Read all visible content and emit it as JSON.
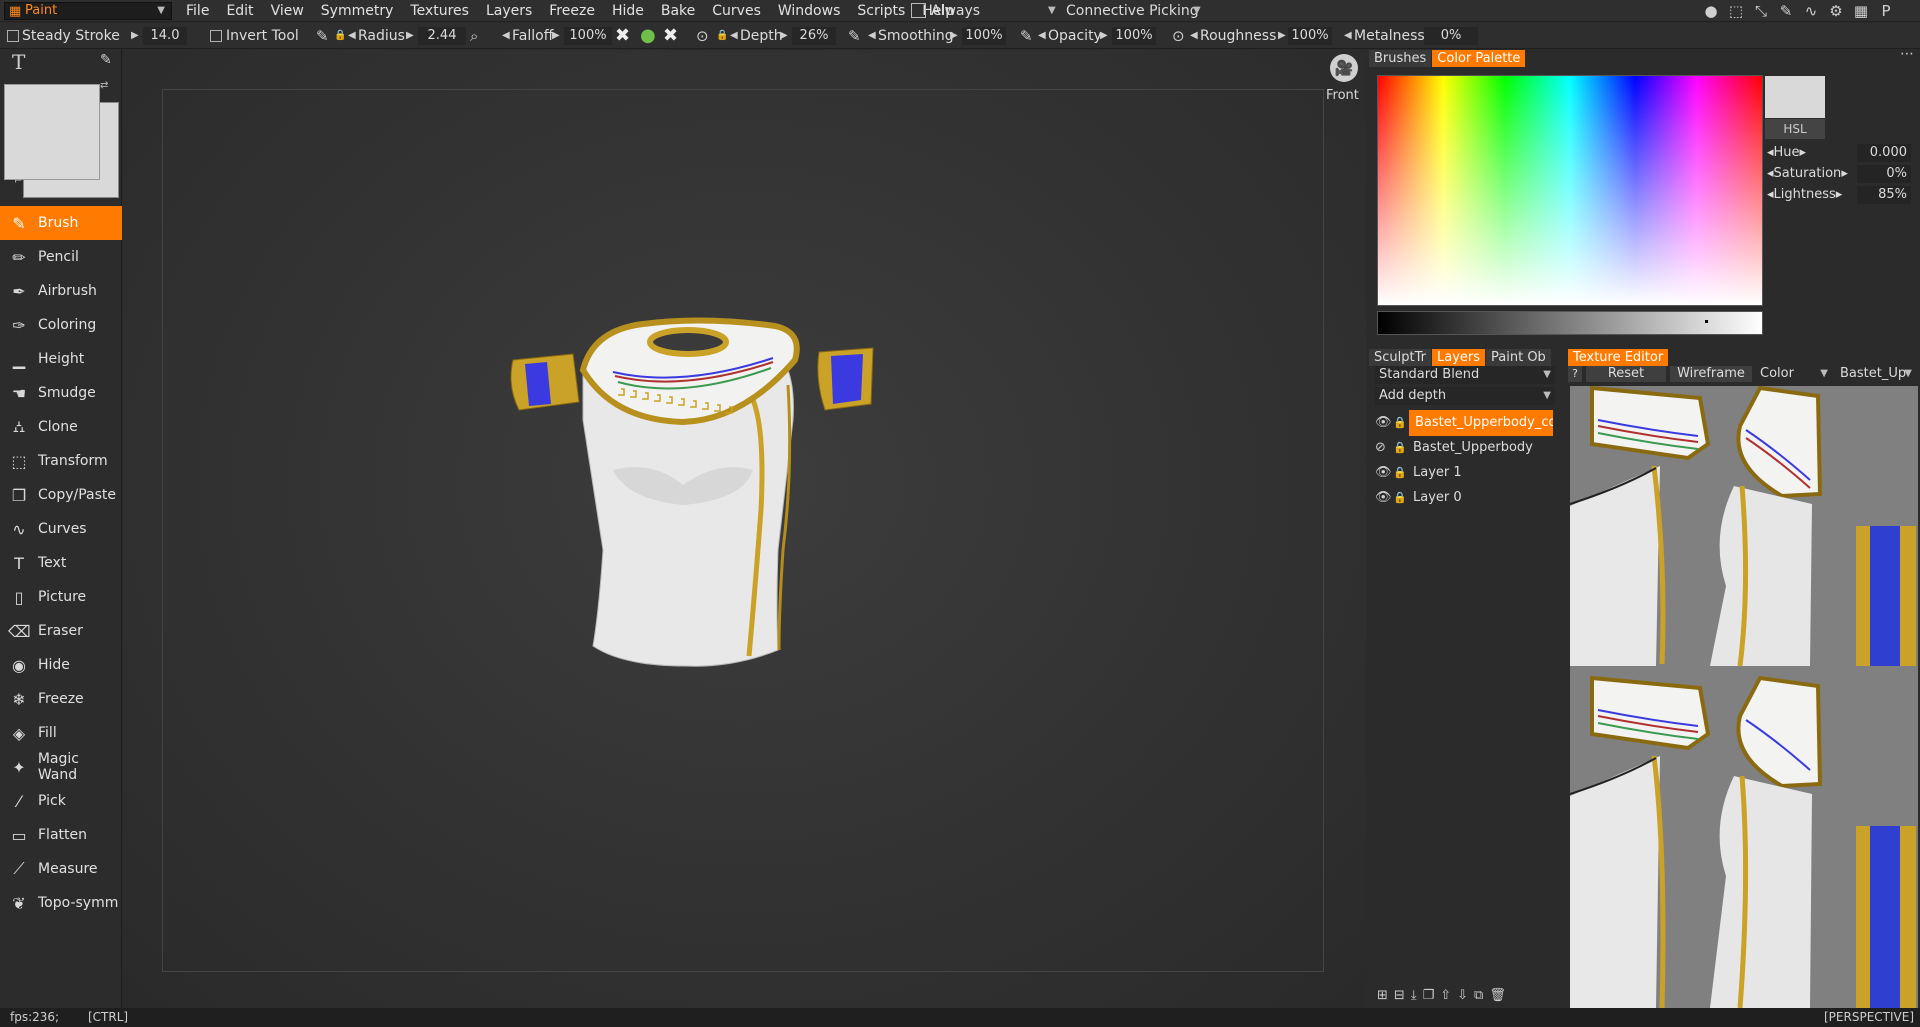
{
  "menubar": {
    "mode": "Paint",
    "menus": [
      "File",
      "Edit",
      "View",
      "Symmetry",
      "Textures",
      "Layers",
      "Freeze",
      "Hide",
      "Bake",
      "Curves",
      "Windows",
      "Scripts",
      "Help"
    ],
    "always_label": "Always",
    "picking_label": "Connective Picking"
  },
  "options": {
    "steady_stroke": "Steady Stroke",
    "steady_value": "14.0",
    "invert_tool": "Invert Tool",
    "radius_label": "Radius",
    "radius_value": "2.44",
    "falloff_label": "Falloff",
    "falloff_value": "100%",
    "depth_label": "Depth",
    "depth_value": "26%",
    "smoothing_label": "Smoothing",
    "smoothing_value": "100%",
    "opacity_label": "Opacity",
    "opacity_value": "100%",
    "roughness_label": "Roughness",
    "roughness_value": "100%",
    "metalness_label": "Metalness",
    "metalness_value": "0%"
  },
  "tools": [
    {
      "label": "Brush",
      "icon": "brush-icon",
      "glyph": "✎",
      "active": true
    },
    {
      "label": "Pencil",
      "icon": "pencil-icon",
      "glyph": "✏",
      "active": false
    },
    {
      "label": "Airbrush",
      "icon": "airbrush-icon",
      "glyph": "✒",
      "active": false
    },
    {
      "label": "Coloring",
      "icon": "coloring-icon",
      "glyph": "✑",
      "active": false
    },
    {
      "label": "Height",
      "icon": "height-icon",
      "glyph": "▁",
      "active": false
    },
    {
      "label": "Smudge",
      "icon": "smudge-icon",
      "glyph": "☚",
      "active": false
    },
    {
      "label": "Clone",
      "icon": "clone-icon",
      "glyph": "⛼",
      "active": false
    },
    {
      "label": "Transform",
      "icon": "transform-icon",
      "glyph": "⬚",
      "active": false
    },
    {
      "label": "Copy/Paste",
      "icon": "copy-paste-icon",
      "glyph": "❐",
      "active": false
    },
    {
      "label": "Curves",
      "icon": "curves-icon",
      "glyph": "∿",
      "active": false
    },
    {
      "label": "Text",
      "icon": "text-icon",
      "glyph": "T",
      "active": false
    },
    {
      "label": "Picture",
      "icon": "picture-icon",
      "glyph": "▯",
      "active": false
    },
    {
      "label": "Eraser",
      "icon": "eraser-icon",
      "glyph": "⌫",
      "active": false
    },
    {
      "label": "Hide",
      "icon": "hide-icon",
      "glyph": "◉",
      "active": false
    },
    {
      "label": "Freeze",
      "icon": "freeze-icon",
      "glyph": "❄",
      "active": false
    },
    {
      "label": "Fill",
      "icon": "fill-icon",
      "glyph": "◈",
      "active": false
    },
    {
      "label": "Magic Wand",
      "icon": "magic-wand-icon",
      "glyph": "✦",
      "active": false
    },
    {
      "label": "Pick",
      "icon": "pick-icon",
      "glyph": "⁄",
      "active": false
    },
    {
      "label": "Flatten",
      "icon": "flatten-icon",
      "glyph": "▭",
      "active": false
    },
    {
      "label": "Measure",
      "icon": "measure-icon",
      "glyph": "⟋",
      "active": false
    },
    {
      "label": "Topo-symm",
      "icon": "topo-symm-icon",
      "glyph": "❦",
      "active": false
    }
  ],
  "viewport": {
    "view_name": "Front"
  },
  "palette": {
    "tabs": [
      {
        "label": "Brushes",
        "active": false
      },
      {
        "label": "Color Palette",
        "active": true
      }
    ],
    "current_color": "#d9d9d9",
    "hsl_button": "HSL",
    "hue_label": "Hue",
    "hue_value": "0.000",
    "saturation_label": "Saturation",
    "saturation_value": "0%",
    "lightness_label": "Lightness",
    "lightness_value": "85%"
  },
  "layers_panel": {
    "tabs": [
      {
        "label": "SculptTr",
        "active": false
      },
      {
        "label": "Layers",
        "active": true
      },
      {
        "label": "Paint Ob",
        "active": false
      }
    ],
    "blend_mode": "Standard Blend",
    "depth_mode": "Add depth",
    "layers": [
      {
        "name": "Bastet_Upperbody_co",
        "selected": true,
        "visible": true
      },
      {
        "name": "Bastet_Upperbody",
        "selected": false,
        "visible": false
      },
      {
        "name": "Layer 1",
        "selected": false,
        "visible": true
      },
      {
        "name": "Layer 0",
        "selected": false,
        "visible": true
      }
    ]
  },
  "texture_editor": {
    "tab": "Texture Editor",
    "help": "?",
    "reset": "Reset",
    "wireframe": "Wireframe",
    "channel": "Color",
    "map": "Bastet_Up"
  },
  "statusbar": {
    "fps": "fps:236;",
    "modifier": "[CTRL]",
    "projection": "[PERSPECTIVE]"
  },
  "colors": {
    "accent": "#ff7a00",
    "gold": "#c9a227",
    "blue": "#3a3ae0",
    "shirt": "#e6e6e6"
  }
}
